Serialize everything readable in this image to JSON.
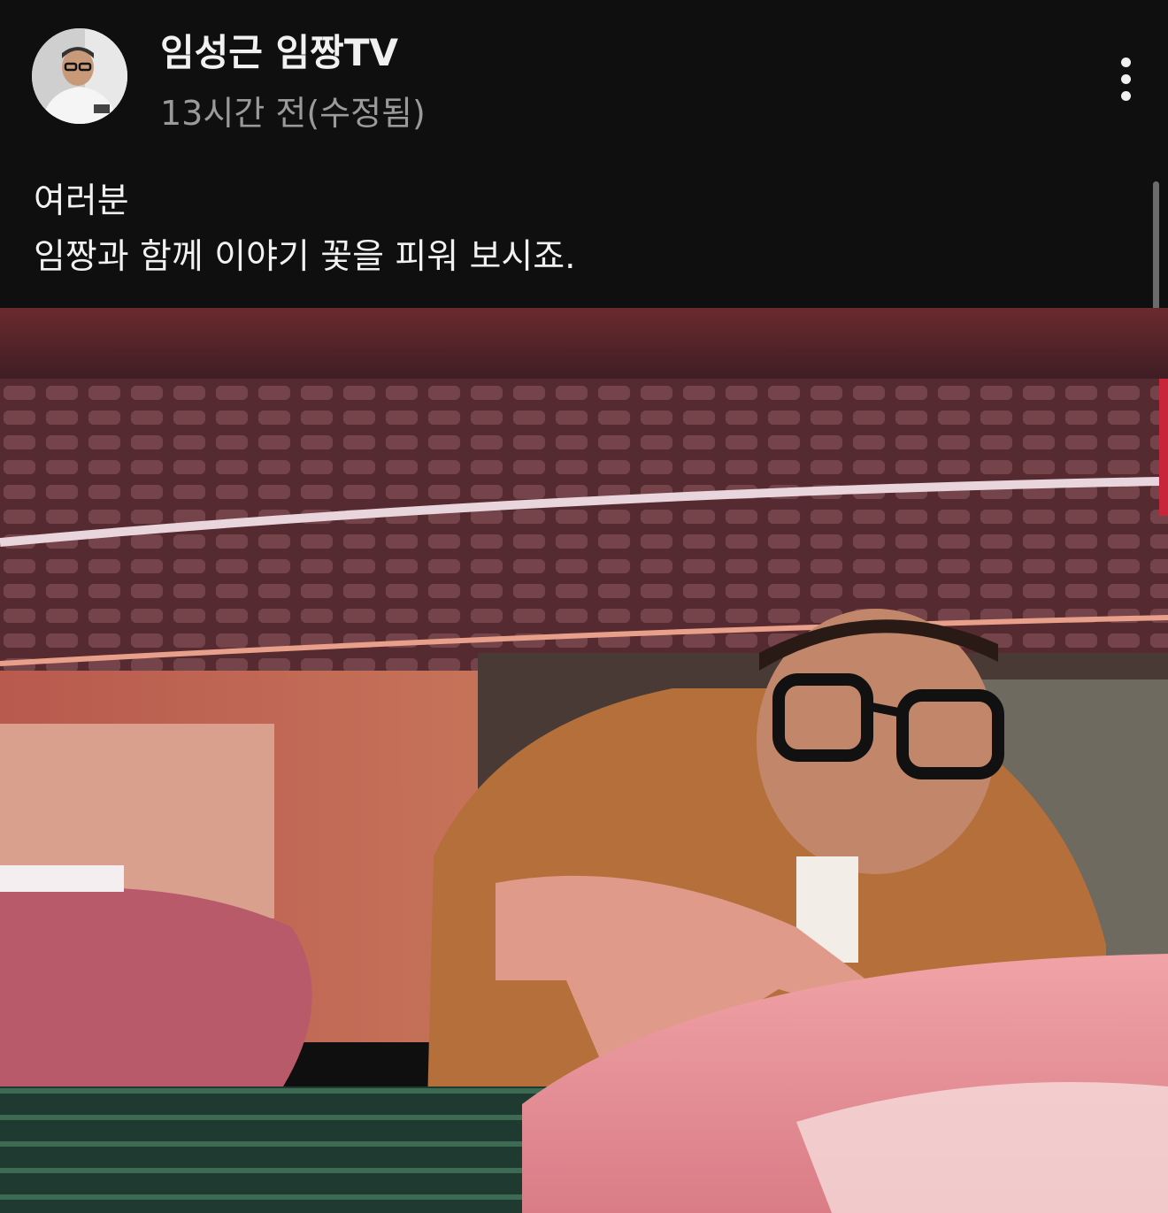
{
  "post": {
    "channel_name": "임성근 임짱TV",
    "timestamp": "13시간 전(수정됨)",
    "text_lines": [
      "여러분",
      "임짱과 함께 이야기 꽃을 피워 보시죠."
    ]
  },
  "icons": {
    "more": "more-vertical-icon"
  },
  "colors": {
    "background": "#0f0f0f",
    "primary_text": "#f1f1f1",
    "secondary_text": "#9a9a9a"
  }
}
